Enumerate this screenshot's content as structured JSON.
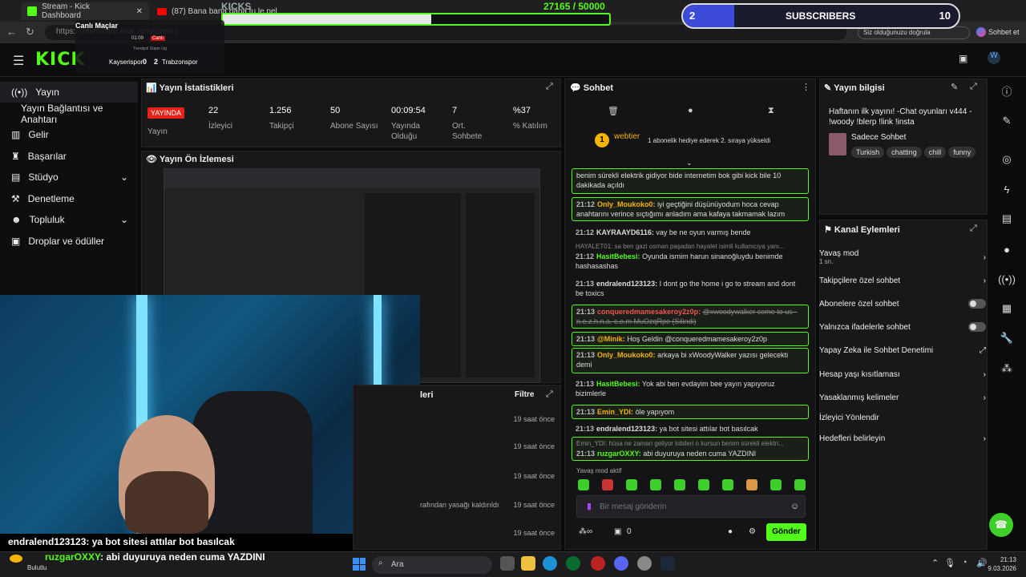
{
  "browser": {
    "tab1": "Stream - Kick Dashboard",
    "tab2": "(87) Bana bana bana tu le pel",
    "url": "https://dashboard.kick.com/stream",
    "search_hint": "Siz olduğunuzu doğrula",
    "chat_link": "Sohbet et"
  },
  "overlay": {
    "kicks_label": "KICKS",
    "kicks_progress": "27165 / 50000",
    "kicks_fraction": 0.54,
    "subs_count": "2",
    "subs_label": "SUBSCRIBERS",
    "subs_goal": "10",
    "match_title": "Canlı Maçlar",
    "match_time": "01:09",
    "match_live": "Canlı",
    "match_league": "Trendyol Süper Lig",
    "team_home": "Kayserispor",
    "score_home": "0",
    "score_away": "2",
    "team_away": "Trabzonspor",
    "ticker1_user": "endralend123123",
    "ticker1_msg": ": ya bot sitesi attılar bot basılcak",
    "ticker2_user": "ruzgarOXXY",
    "ticker2_msg": ": abi duyuruya neden cuma YAZDINI"
  },
  "sidebar": {
    "items": [
      {
        "label": "Yayın",
        "icon": "signal-icon"
      },
      {
        "label": "Yayın Bağlantısı ve Anahtarı",
        "icon": ""
      },
      {
        "label": "Gelir",
        "icon": "chart-icon"
      },
      {
        "label": "Başarılar",
        "icon": "trophy-icon"
      },
      {
        "label": "Stüdyo",
        "icon": "studio-icon"
      },
      {
        "label": "Denetleme",
        "icon": "hammer-icon"
      },
      {
        "label": "Topluluk",
        "icon": "people-icon"
      },
      {
        "label": "Droplar ve ödüller",
        "icon": "gift-icon"
      }
    ]
  },
  "stats": {
    "title": "Yayın İstatistikleri",
    "live_badge": "YAYINDA",
    "live_label": "Yayın",
    "items": [
      {
        "value": "22",
        "label": "İzleyici"
      },
      {
        "value": "1.256",
        "label": "Takipçi"
      },
      {
        "value": "50",
        "label": "Abone Sayısı"
      },
      {
        "value": "00:09:54",
        "label": "Yayında Olduğu"
      },
      {
        "value": "7",
        "label": "Ort. Sohbete"
      },
      {
        "value": "%37",
        "label": "% Katılım"
      }
    ]
  },
  "preview": {
    "title": "Yayın Ön İzlemesi"
  },
  "recent": {
    "title_fragment": "leri",
    "filter": "Filtre",
    "rows": [
      {
        "text": "",
        "time": "19 saat önce"
      },
      {
        "text": "",
        "time": "19 saat önce"
      },
      {
        "text": "",
        "time": "19 saat önce"
      },
      {
        "text": "rafından yasağı kaldırıldı",
        "time": "19 saat önce"
      },
      {
        "text": "",
        "time": "19 saat önce"
      }
    ]
  },
  "chat": {
    "title": "Sohbet",
    "pinned_user": "webtier",
    "pinned_rank": "1",
    "pinned_text": "1 abonelik hediye ederek 2. sıraya yükseldi",
    "messages": [
      {
        "time": "",
        "user": "",
        "text": "benim sürekli elektrik gidiyor bide internetim bok gibi kick bile 10 dakikada açıldı",
        "hl": true
      },
      {
        "time": "21:12",
        "user": "Only_Moukoko0:",
        "text": "iyi geçtiğini düşünüyodum hoca cevap anahtarını verince sıçtığımı anladım ama kafaya takmamak lazım",
        "hl": true
      },
      {
        "time": "21:12",
        "user": "KAYRAAYD6116:",
        "text": "vay be ne oyun varmış bende",
        "hl": false
      },
      {
        "time": "",
        "user": "",
        "text": "HAYALET01: sa ben gazi osman paşadan hayalet isimli kullanıcıya yanı...",
        "hl": false
      },
      {
        "time": "21:12",
        "user": "HasitBebesi:",
        "text": "Oyunda ismim harun sinanoğluydu benimde hashasashas",
        "hl": false
      },
      {
        "time": "21:13",
        "user": "endralend123123:",
        "text": "I dont go the home i go to stream and dont be toxics",
        "hl": false
      },
      {
        "time": "21:13",
        "user": "conqueredmamesakeroy2z0p:",
        "text": "@xwoodywalker come to us - n.e.z.h.n.a. c.o.m MuOzqRpe (Silindi)",
        "hl": true
      },
      {
        "time": "21:13",
        "user": "@Minik:",
        "text": "Hoş Geldin @conqueredmamesakeroy2z0p",
        "hl": true
      },
      {
        "time": "21:13",
        "user": "Only_Moukoko0:",
        "text": "arkaya bi xWoodyWalker yazısı gelecekti demi",
        "hl": true
      },
      {
        "time": "21:13",
        "user": "HasitBebesi:",
        "text": "Yok abi ben evdayim bee yayın yapıyoruz bizimlerle",
        "hl": false
      },
      {
        "time": "21:13",
        "user": "Emin_YDI:",
        "text": "öle yapıyom",
        "hl": true
      },
      {
        "time": "21:13",
        "user": "endralend123123:",
        "text": "ya bot sitesi attılar bot basılcak",
        "hl": false
      },
      {
        "time": "",
        "user": "",
        "text": "Emin_YDI: hüsa ne zaman geliyor lobileri o kursun benim sürekli elektri...",
        "hl": false
      },
      {
        "time": "21:13",
        "user": "ruzgarOXXY:",
        "text": "abi duyuruya neden cuma YAZDINI",
        "hl": false
      }
    ],
    "slow_mode": "Yavaş mod aktif",
    "placeholder": "Bir mesaj gönderin",
    "count": "0",
    "send": "Gönder"
  },
  "info": {
    "title": "Yayın bilgisi",
    "stream_title": "Haftanın ilk yayını! -Chat oyunları v444 - !woody !blerp !link !insta",
    "category": "Sadece Sohbet",
    "tags": [
      "Turkish",
      "chatting",
      "chill",
      "funny"
    ]
  },
  "actions": {
    "title": "Kanal Eylemleri",
    "rows": [
      {
        "label": "Yavaş mod",
        "sub": "1 sn.",
        "ctrl": "chevron"
      },
      {
        "label": "Takipçilere özel sohbet",
        "sub": "",
        "ctrl": "chevron"
      },
      {
        "label": "Abonelere özel sohbet",
        "sub": "",
        "ctrl": "toggle"
      },
      {
        "label": "Yalnızca ifadelerle sohbet",
        "sub": "",
        "ctrl": "toggle"
      },
      {
        "label": "Yapay Zeka ile Sohbet Denetimi",
        "sub": "",
        "ctrl": "external"
      },
      {
        "label": "Hesap yaşı kısıtlaması",
        "sub": "",
        "ctrl": "chevron"
      },
      {
        "label": "Yasaklanmış kelimeler",
        "sub": "",
        "ctrl": "chevron"
      },
      {
        "label": "İzleyici Yönlendir",
        "sub": "",
        "ctrl": "none"
      },
      {
        "label": "Hedefleri belirleyin",
        "sub": "",
        "ctrl": "chevron"
      }
    ]
  },
  "taskbar": {
    "weather": "Bulutlu",
    "search": "Ara",
    "time": "21:13",
    "date": "9.03.2026"
  },
  "colors": {
    "accent": "#53fc18",
    "live": "#e62117",
    "panel": "#18181b"
  }
}
